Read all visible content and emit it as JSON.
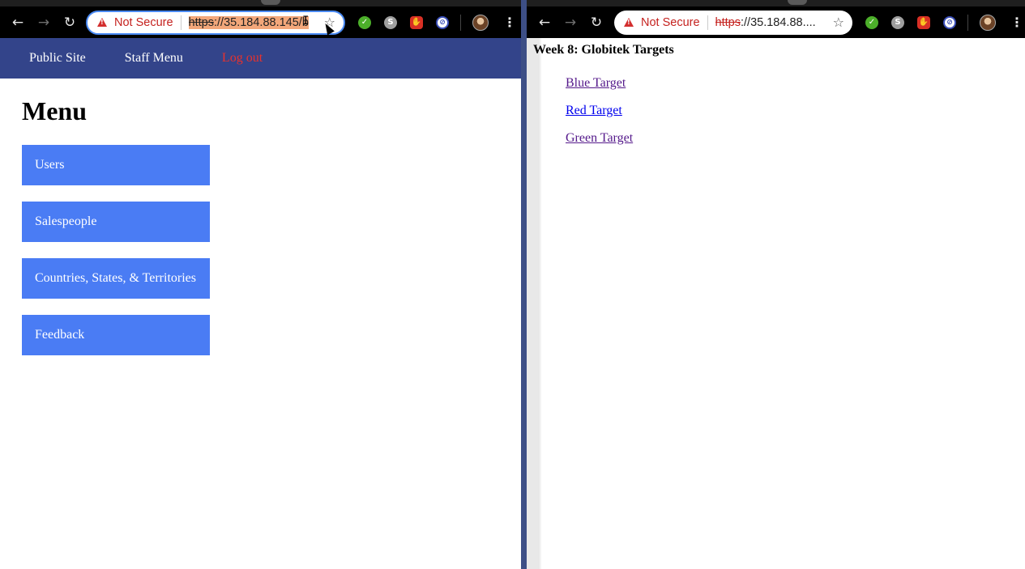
{
  "left_browser": {
    "omnibox": {
      "security_label": "Not Secure",
      "url_scheme": "https",
      "url_rest": "://35.184.88.145/b"
    },
    "nav_icons": [
      "back-icon",
      "forward-icon",
      "reload-icon"
    ],
    "extensions": [
      "check-extension-icon",
      "skype-extension-icon",
      "adblock-extension-icon",
      "blocker-extension-icon"
    ],
    "site_nav": {
      "public_site": "Public Site",
      "staff_menu": "Staff Menu",
      "logout": "Log out"
    },
    "page": {
      "heading": "Menu",
      "buttons": [
        "Users",
        "Salespeople",
        "Countries, States, & Territories",
        "Feedback"
      ]
    },
    "colors": {
      "nav_bg": "#33448a",
      "button_bg": "#4a7cf4",
      "logout": "#e8322d"
    }
  },
  "right_browser": {
    "omnibox": {
      "security_label": "Not Secure",
      "url_scheme": "https",
      "url_rest": "://35.184.88...."
    },
    "page": {
      "title": "Week 8: Globitek Targets",
      "links": [
        {
          "label": "Blue Target",
          "visited": true
        },
        {
          "label": "Red Target",
          "visited": false
        },
        {
          "label": "Green Target",
          "visited": true
        }
      ]
    }
  }
}
